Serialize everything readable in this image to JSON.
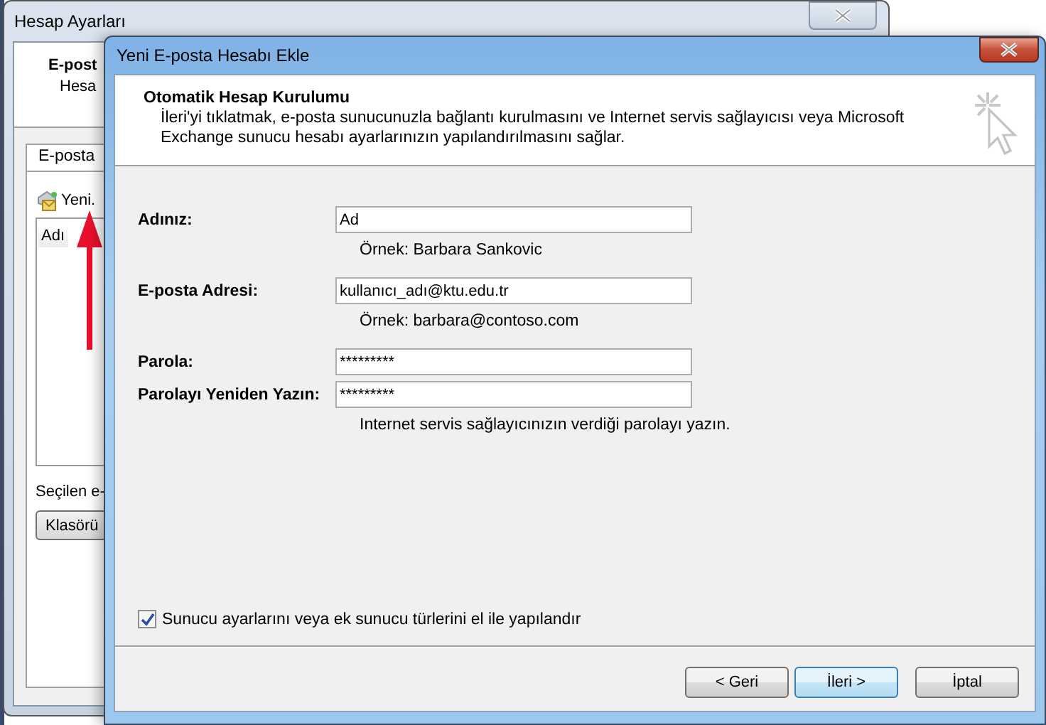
{
  "back_window": {
    "title": "Hesap Ayarları",
    "header_title": "E-post",
    "header_subtitle": "Hesa",
    "tabs": [
      {
        "label": "E-posta",
        "selected": true
      }
    ],
    "new_button": "Yeni.",
    "list_column": "Adı",
    "selected_label": "Seçilen e-",
    "folder_button": "Klasörü"
  },
  "dialog": {
    "title": "Yeni E-posta Hesabı Ekle",
    "heading": "Otomatik Hesap Kurulumu",
    "description": "İleri'yi tıklatmak, e-posta sunucunuzla bağlantı kurulmasını ve Internet servis sağlayıcısı veya Microsoft Exchange sunucu hesabı ayarlarınızın yapılandırılmasını sağlar.",
    "fields": [
      {
        "label": "Adınız:",
        "value": "Ad",
        "hint": "Örnek: Barbara Sankovic"
      },
      {
        "label": "E-posta Adresi:",
        "value": "kullanıcı_adı@ktu.edu.tr",
        "hint": "Örnek: barbara@contoso.com"
      },
      {
        "label": "Parola:",
        "value": "*********"
      },
      {
        "label": "Parolayı Yeniden Yazın:",
        "value": "*********",
        "hint": "Internet servis sağlayıcınızın verdiği parolayı yazın."
      }
    ],
    "manual_setup": {
      "label": "Sunucu ayarlarını veya ek sunucu türlerini el ile yapılandır",
      "checked": true
    },
    "buttons": [
      {
        "label": "< Geri",
        "default": false
      },
      {
        "label": "İleri >",
        "default": true
      },
      {
        "label": "İptal",
        "default": false
      }
    ]
  }
}
